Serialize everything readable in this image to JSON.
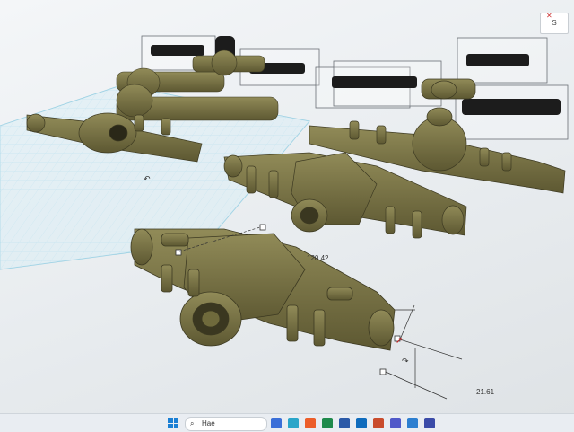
{
  "viewport": {
    "dimension_width": "120.42",
    "dimension_height": "21.61",
    "topright_label": "S"
  },
  "taskbar": {
    "search_text": "Hae",
    "icons": [
      {
        "name": "start-icon",
        "color": "#1a7fd4"
      },
      {
        "name": "chat-icon",
        "color": "#3b6fd8"
      },
      {
        "name": "edge-icon",
        "color": "#2aa5c9"
      },
      {
        "name": "store-icon",
        "color": "#ec5e2a"
      },
      {
        "name": "excel-icon",
        "color": "#1f8a4c"
      },
      {
        "name": "word-icon",
        "color": "#2b5aa8"
      },
      {
        "name": "outlook-icon",
        "color": "#0f6cbd"
      },
      {
        "name": "powerpoint-icon",
        "color": "#c94c2d"
      },
      {
        "name": "teams-icon",
        "color": "#5059c9"
      },
      {
        "name": "app-icon",
        "color": "#2d7fd0"
      },
      {
        "name": "app2-icon",
        "color": "#3b4ba8"
      }
    ]
  },
  "colors": {
    "part": "#6f6a3c",
    "part_dark": "#4b472a",
    "part_light": "#8d8756",
    "grid": "#bfe3ef",
    "black_part": "#1c1c1c"
  }
}
